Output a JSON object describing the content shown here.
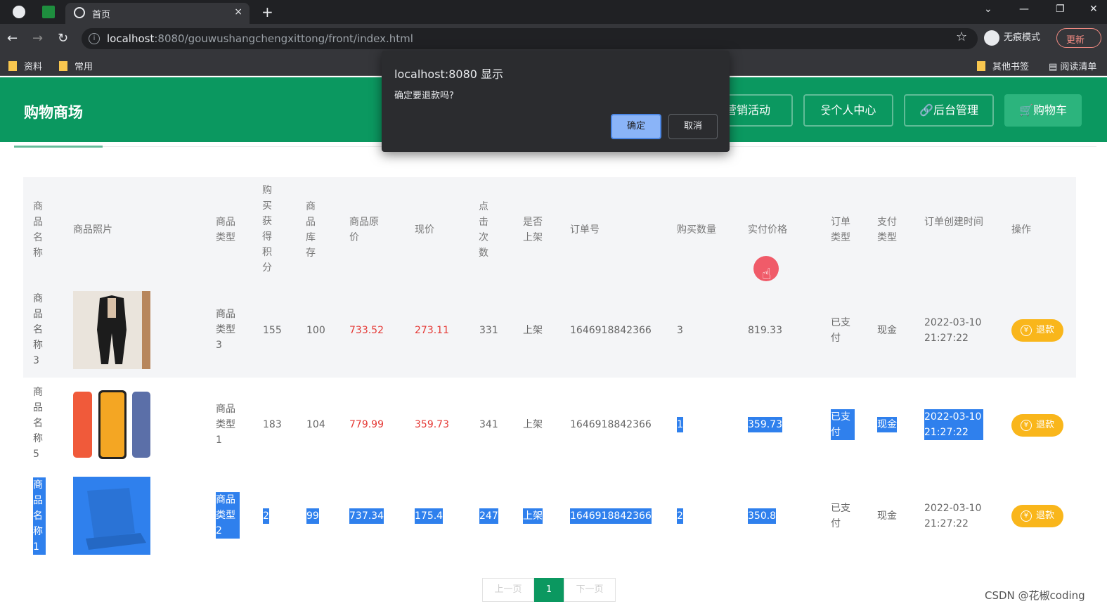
{
  "browser": {
    "tab_title": "首页",
    "new_tab": "+",
    "close_tab": "×",
    "url_host": "localhost",
    "url_rest": ":8080/gouwushangchengxittong/front/index.html",
    "incognito_label": "无痕模式",
    "update_label": "更新",
    "bookmarks": [
      "资料",
      "常用"
    ],
    "bookmarks_right": [
      "其他书签",
      "阅读清单"
    ]
  },
  "header": {
    "site_title": "购物商场",
    "buttons": [
      "营销活动",
      "个人中心",
      "后台管理",
      "购物车"
    ]
  },
  "dialog": {
    "title": "localhost:8080 显示",
    "message": "确定要退款吗?",
    "ok_label": "确定",
    "cancel_label": "取消"
  },
  "table": {
    "columns": [
      "商品名称",
      "商品照片",
      "商品类型",
      "购买获得积分",
      "商品库存",
      "商品原价",
      "现价",
      "点击次数",
      "是否上架",
      "订单号",
      "购买数量",
      "实付价格",
      "订单类型",
      "支付类型",
      "订单创建时间",
      "操作"
    ],
    "rows": [
      {
        "name": "商品名称3",
        "photo": "suit",
        "type": "商品类型3",
        "points": "155",
        "stock": "100",
        "orig": "733.52",
        "price": "273.11",
        "clicks": "331",
        "onsale": "上架",
        "order_no": "1646918842366",
        "qty": "3",
        "paid": "819.33",
        "order_type": "已支付",
        "pay_type": "现金",
        "created": "2022-03-10 21:27:22",
        "action": "退款"
      },
      {
        "name": "商品名称5",
        "photo": "phones",
        "type": "商品类型1",
        "points": "183",
        "stock": "104",
        "orig": "779.99",
        "price": "359.73",
        "clicks": "341",
        "onsale": "上架",
        "order_no": "1646918842366",
        "qty": "1",
        "paid": "359.73",
        "order_type": "已支付",
        "pay_type": "现金",
        "created": "2022-03-10 21:27:22",
        "action": "退款"
      },
      {
        "name": "商品名称1",
        "photo": "laptop",
        "type": "商品类型2",
        "points": "2",
        "stock": "99",
        "orig": "737.34",
        "price": "175.4",
        "clicks": "247",
        "onsale": "上架",
        "order_no": "1646918842366",
        "qty": "2",
        "paid": "350.8",
        "order_type": "已支付",
        "pay_type": "现金",
        "created": "2022-03-10 21:27:22",
        "action": "退款"
      }
    ]
  },
  "pagination": {
    "prev": "上一页",
    "current": "1",
    "next": "下一页"
  },
  "watermark": "CSDN @花椒coding"
}
